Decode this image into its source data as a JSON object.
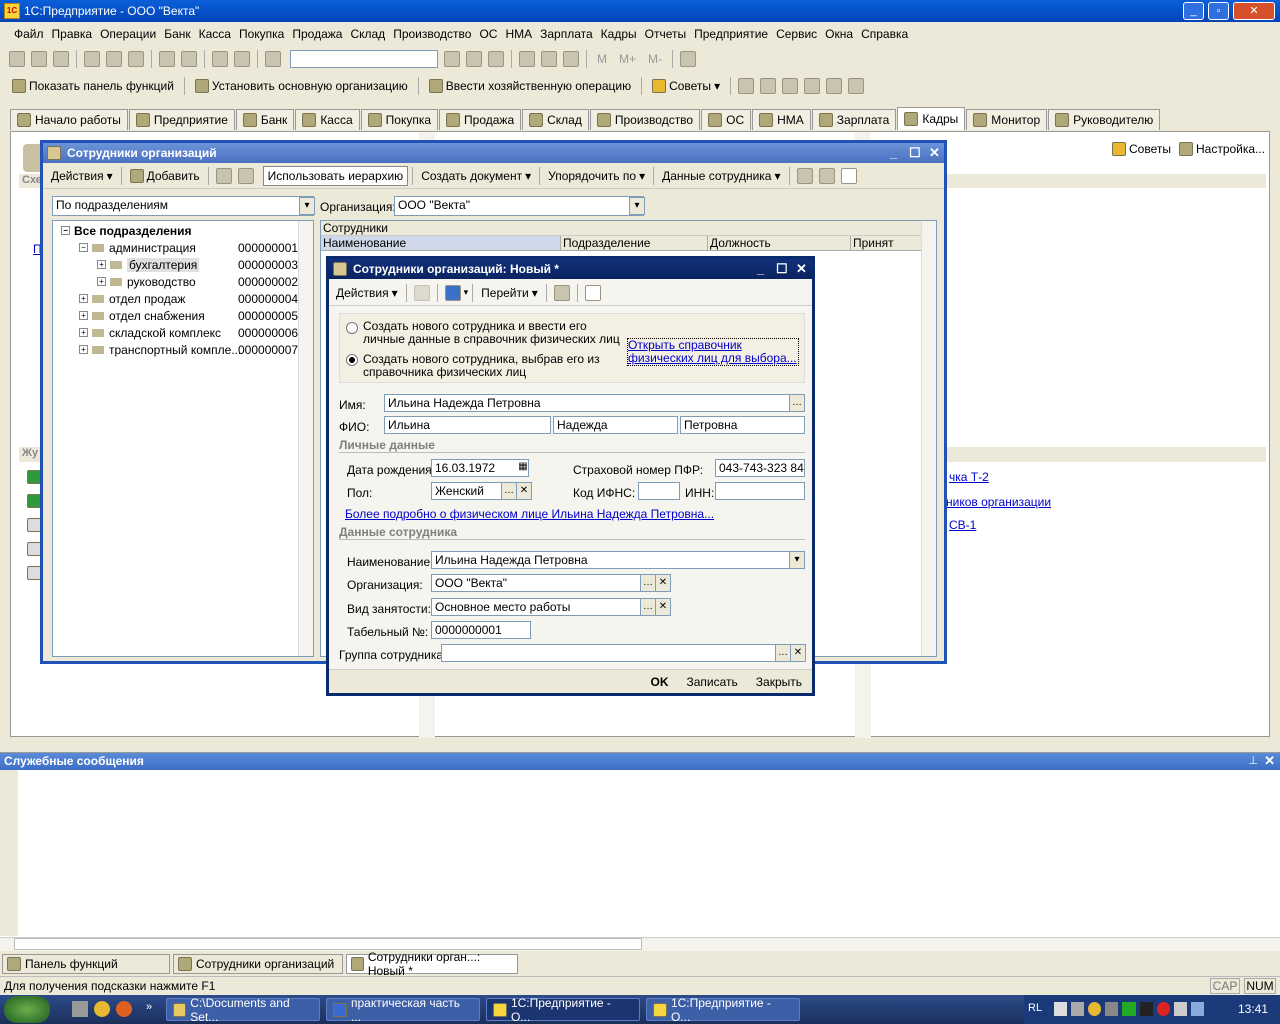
{
  "app": {
    "title": "1С:Предприятие - ООО \"Векта\""
  },
  "menu": [
    "Файл",
    "Правка",
    "Операции",
    "Банк",
    "Касса",
    "Покупка",
    "Продажа",
    "Склад",
    "Производство",
    "ОС",
    "НМА",
    "Зарплата",
    "Кадры",
    "Отчеты",
    "Предприятие",
    "Сервис",
    "Окна",
    "Справка"
  ],
  "toolbar2": {
    "show_panel": "Показать панель функций",
    "set_org": "Установить основную организацию",
    "enter_op": "Ввести хозяйственную операцию",
    "tips": "Советы"
  },
  "toolbar1": {
    "m1": "M",
    "m2": "M+",
    "m3": "M-"
  },
  "sections": [
    "Начало работы",
    "Предприятие",
    "Банк",
    "Касса",
    "Покупка",
    "Продажа",
    "Склад",
    "Производство",
    "ОС",
    "НМА",
    "Зарплата",
    "Кадры",
    "Монитор",
    "Руководителю"
  ],
  "right_panel": {
    "tips": "Советы",
    "settings": "Настройка...",
    "link1": "чка Т-2",
    "link2": "ников организации",
    "link3": "СВ-1",
    "partial1": "Схе",
    "partial2": "Жу",
    "partial3": "П"
  },
  "list_window": {
    "title": "Сотрудники организаций",
    "actions": "Действия",
    "add": "Добавить",
    "use_hierarchy": "Использовать иерархию",
    "create_doc": "Создать документ",
    "order_by": "Упорядочить по",
    "employee_data": "Данные сотрудника",
    "group_by": "По подразделениям",
    "org_label": "Организация:",
    "org_value": "ООО \"Векта\"",
    "grid_title": "Сотрудники",
    "columns": [
      "Наименование",
      "Подразделение",
      "Должность",
      "Принят"
    ],
    "tree_root": "Все подразделения",
    "tree": [
      {
        "name": "администрация",
        "code": "000000001"
      },
      {
        "name": "бухгалтерия",
        "code": "000000003"
      },
      {
        "name": "руководство",
        "code": "000000002"
      },
      {
        "name": "отдел продаж",
        "code": "000000004"
      },
      {
        "name": "отдел снабжения",
        "code": "000000005"
      },
      {
        "name": "складской комплекс",
        "code": "000000006"
      },
      {
        "name": "транспортный компле...",
        "code": "000000007"
      }
    ]
  },
  "form": {
    "title": "Сотрудники организаций: Новый *",
    "actions": "Действия",
    "goto": "Перейти",
    "radio1": "Создать нового сотрудника и ввести его личные данные в справочник физических лиц",
    "radio2": "Создать нового сотрудника, выбрав его из справочника физических лиц",
    "open_link": "Открыть справочник физических лиц для выбора...",
    "name_label": "Имя:",
    "name_value": "Ильина Надежда Петровна",
    "fio_label": "ФИО:",
    "fio_last": "Ильина",
    "fio_first": "Надежда",
    "fio_middle": "Петровна",
    "personal_hdr": "Личные данные",
    "birth_label": "Дата рождения:",
    "birth_value": "16.03.1972",
    "pfr_label": "Страховой номер ПФР:",
    "pfr_value": "043-743-323 84",
    "sex_label": "Пол:",
    "sex_value": "Женский",
    "ifns_label": "Код ИФНС:",
    "inn_label": "ИНН:",
    "more_link": "Более подробно о физическом лице Ильина Надежда Петровна...",
    "emp_hdr": "Данные сотрудника",
    "emp_name_label": "Наименование:",
    "emp_name_value": "Ильина Надежда Петровна",
    "org_label": "Организация:",
    "org_value": "ООО \"Векта\"",
    "empl_type_label": "Вид занятости:",
    "empl_type_value": "Основное место работы",
    "tab_no_label": "Табельный №:",
    "tab_no_value": "0000000001",
    "group_label": "Группа сотрудника:",
    "ok": "OK",
    "save": "Записать",
    "close": "Закрыть"
  },
  "messages": {
    "title": "Служебные сообщения"
  },
  "window_tabs": [
    "Панель функций",
    "Сотрудники организаций",
    "Сотрудники орган...: Новый *"
  ],
  "status": {
    "hint": "Для получения подсказки нажмите F1",
    "cap": "CAP",
    "num": "NUM"
  },
  "taskbar": {
    "items": [
      "C:\\Documents and Set...",
      "практическая часть ...",
      "1С:Предприятие - О...",
      "1С:Предприятие - О..."
    ],
    "lang": "RL",
    "time": "13:41"
  }
}
